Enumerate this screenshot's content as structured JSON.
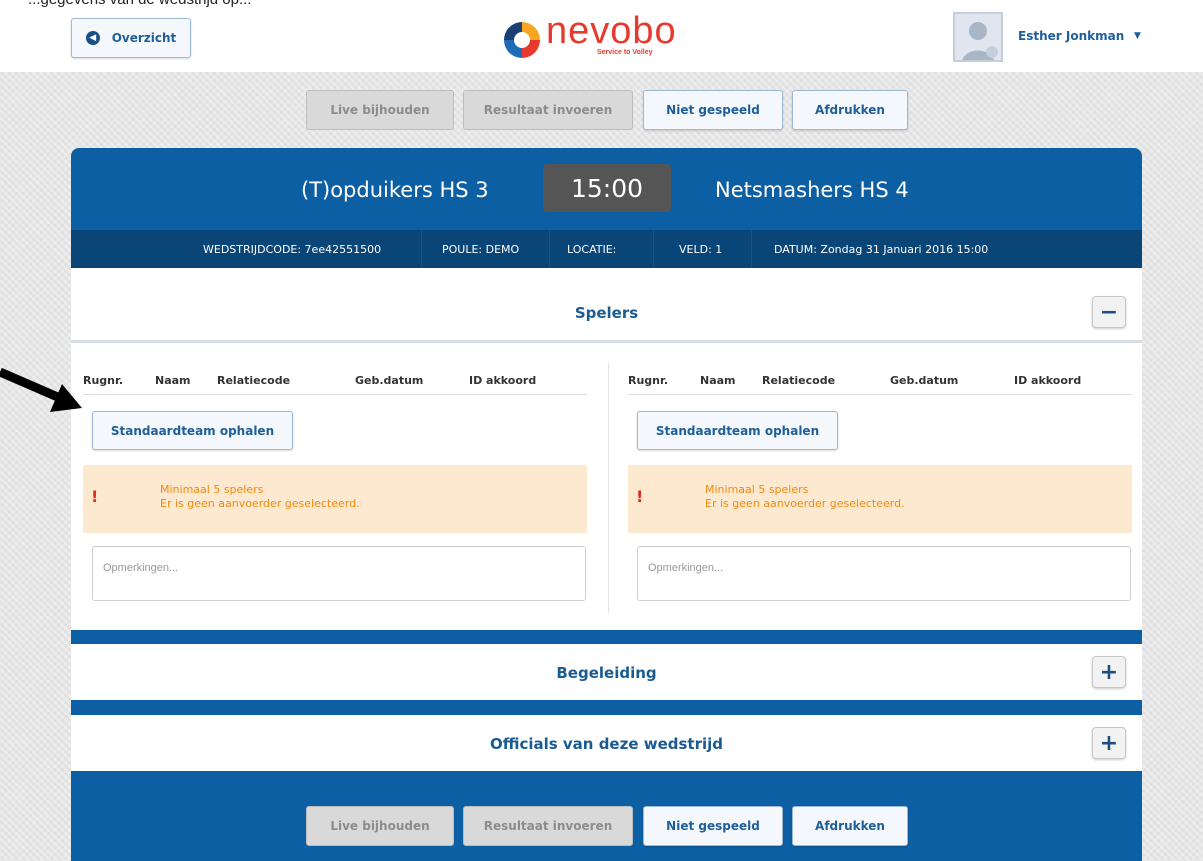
{
  "header": {
    "caption_cut": "...gegevens van de wedstrijd op...",
    "back_label": "Overzicht",
    "brand": {
      "name": "nevobo",
      "tagline": "Service to Volley",
      "color": "#e8392f"
    },
    "user_name": "Esther Jonkman"
  },
  "actions": {
    "live": "Live bijhouden",
    "result": "Resultaat invoeren",
    "not_played": "Niet gespeeld",
    "print": "Afdrukken"
  },
  "match": {
    "home_team": "(T)opduikers HS 3",
    "away_team": "Netsmashers HS 4",
    "time": "15:00",
    "info": {
      "code": "WEDSTRIJDCODE: 7ee42551500",
      "poule": "POULE: DEMO",
      "locatie": "LOCATIE:",
      "veld": "VELD: 1",
      "datum": "DATUM: Zondag 31 Januari 2016 15:00"
    }
  },
  "spelers": {
    "title": "Spelers",
    "toggle": "−",
    "columns": [
      "Rugnr.",
      "Naam",
      "Relatiecode",
      "Geb.datum",
      "ID akkoord"
    ],
    "fetch_label": "Standaardteam ophalen",
    "warning_icon": "!",
    "warning_line1": "Minimaal 5 spelers",
    "warning_line2": "Er is geen aanvoerder geselecteerd.",
    "remarks_placeholder": "Opmerkingen..."
  },
  "begeleiding": {
    "title": "Begeleiding",
    "toggle": "+"
  },
  "officials": {
    "title": "Officials van deze wedstrijd",
    "toggle": "+"
  },
  "colors": {
    "primary": "#0d5fa3",
    "info_bar": "#0a4577",
    "clock_bg": "#555555",
    "warning_bg": "#fde9cf",
    "warning_text": "#f08a12"
  }
}
